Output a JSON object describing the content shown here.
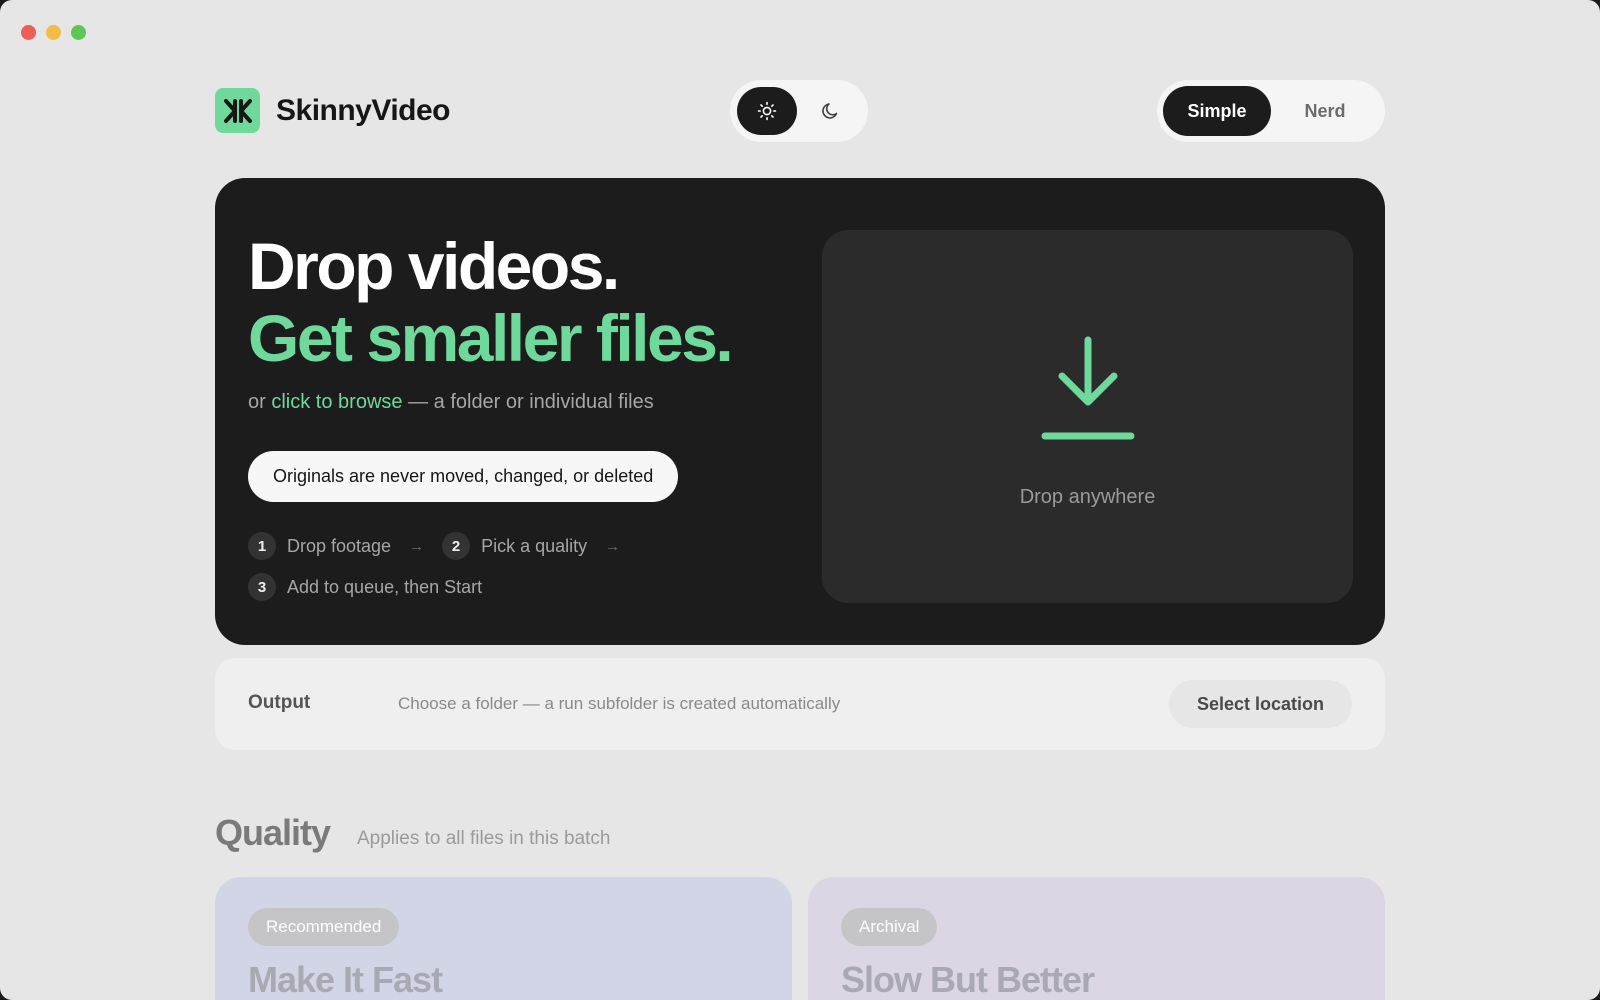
{
  "app": {
    "name": "SkinnyVideo"
  },
  "colors": {
    "accent": "#6ed99a",
    "hero_bg": "#1c1c1c",
    "window_bg": "#e6e6e6"
  },
  "header": {
    "theme_toggle": {
      "options": [
        {
          "icon": "sun-icon",
          "active": true
        },
        {
          "icon": "moon-icon",
          "active": false
        }
      ]
    },
    "mode_toggle": {
      "options": [
        {
          "label": "Simple",
          "active": true
        },
        {
          "label": "Nerd",
          "active": false
        }
      ]
    }
  },
  "hero": {
    "headline_line1": "Drop videos.",
    "headline_line2": "Get smaller files.",
    "subtext_prefix": "or",
    "subtext_link": "click to browse",
    "subtext_suffix": "— a folder or individual files",
    "pill": "Originals are never moved, changed, or deleted",
    "steps": [
      {
        "num": "1",
        "label": "Drop footage"
      },
      {
        "num": "2",
        "label": "Pick a quality"
      },
      {
        "num": "3",
        "label": "Add to queue, then Start"
      }
    ],
    "dropzone": {
      "icon": "download-arrow-icon",
      "label": "Drop anywhere"
    }
  },
  "output": {
    "label": "Output",
    "hint": "Choose a folder — a run subfolder is created automatically",
    "button": "Select location"
  },
  "quality": {
    "title": "Quality",
    "subtitle": "Applies to all files in this batch",
    "cards": [
      {
        "badge": "Recommended",
        "title": "Make It Fast"
      },
      {
        "badge": "Archival",
        "title": "Slow But Better"
      }
    ]
  }
}
